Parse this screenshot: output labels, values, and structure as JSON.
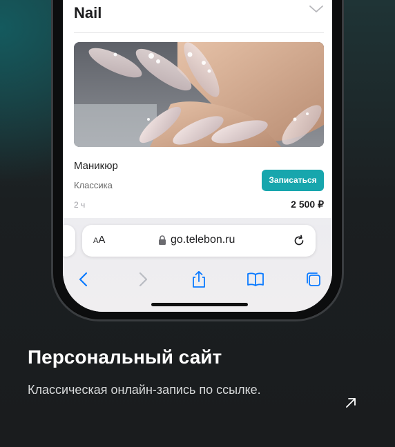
{
  "category": {
    "title": "Nail"
  },
  "service": {
    "name": "Маникюр",
    "subtitle": "Классика",
    "button_label": "Записаться",
    "duration": "2 ч",
    "price": "2 500 ₽"
  },
  "browser": {
    "text_size_label_small": "A",
    "text_size_label_large": "A",
    "url": "go.telebon.ru"
  },
  "promo": {
    "title": "Персональный сайт",
    "description": "Классическая онлайн-запись по ссылке."
  },
  "colors": {
    "accent": "#17a6ad",
    "background": "#1b1d1f",
    "ios_blue": "#0a7aff"
  },
  "icons": {
    "chevron": "chevron-down-icon",
    "lock": "lock-icon",
    "reload": "reload-icon",
    "back": "chevron-left-icon",
    "forward": "chevron-right-icon",
    "share": "share-icon",
    "bookmarks": "book-icon",
    "tabs": "tabs-icon",
    "external": "arrow-up-right-icon"
  }
}
